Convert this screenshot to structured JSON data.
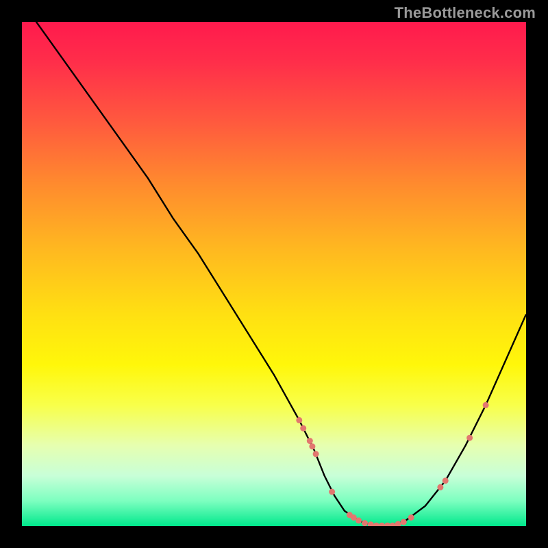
{
  "watermark": "TheBottleneck.com",
  "chart_data": {
    "type": "line",
    "title": "",
    "xlabel": "",
    "ylabel": "",
    "xlim": [
      0,
      100
    ],
    "ylim": [
      0,
      100
    ],
    "series": [
      {
        "name": "bottleneck-curve",
        "x": [
          0,
          5,
          10,
          15,
          20,
          25,
          30,
          35,
          40,
          45,
          50,
          55,
          58,
          60,
          62,
          64,
          67,
          70,
          73,
          76,
          80,
          84,
          88,
          92,
          96,
          100
        ],
        "y": [
          104,
          97,
          90,
          83,
          76,
          69,
          61,
          54,
          46,
          38,
          30,
          21,
          15,
          10,
          6,
          3,
          1,
          0,
          0,
          1,
          4,
          9,
          16,
          24,
          33,
          42
        ]
      }
    ],
    "markers": {
      "name": "highlight-points",
      "color": "#e2776f",
      "points": [
        {
          "x": 55.0,
          "y": 21.0,
          "r": 4.5
        },
        {
          "x": 55.8,
          "y": 19.4,
          "r": 4.5
        },
        {
          "x": 57.1,
          "y": 16.9,
          "r": 4.5
        },
        {
          "x": 57.6,
          "y": 15.8,
          "r": 4.5
        },
        {
          "x": 58.3,
          "y": 14.3,
          "r": 4.5
        },
        {
          "x": 61.5,
          "y": 6.8,
          "r": 4.5
        },
        {
          "x": 65.0,
          "y": 2.2,
          "r": 4.5
        },
        {
          "x": 65.8,
          "y": 1.7,
          "r": 4.5
        },
        {
          "x": 66.8,
          "y": 1.1,
          "r": 4.5
        },
        {
          "x": 68.0,
          "y": 0.6,
          "r": 4.5
        },
        {
          "x": 69.2,
          "y": 0.3,
          "r": 4.5
        },
        {
          "x": 70.3,
          "y": 0.1,
          "r": 4.5
        },
        {
          "x": 71.4,
          "y": 0.1,
          "r": 4.5
        },
        {
          "x": 72.5,
          "y": 0.1,
          "r": 4.5
        },
        {
          "x": 73.5,
          "y": 0.1,
          "r": 4.5
        },
        {
          "x": 74.6,
          "y": 0.4,
          "r": 4.5
        },
        {
          "x": 75.7,
          "y": 0.8,
          "r": 4.5
        },
        {
          "x": 77.2,
          "y": 1.7,
          "r": 4.5
        },
        {
          "x": 83.0,
          "y": 7.7,
          "r": 4.5
        },
        {
          "x": 84.0,
          "y": 9.0,
          "r": 4.5
        },
        {
          "x": 88.8,
          "y": 17.5,
          "r": 4.5
        },
        {
          "x": 92.0,
          "y": 24.0,
          "r": 4.5
        }
      ]
    },
    "background": {
      "type": "vertical-gradient",
      "stops": [
        {
          "pos": 0.0,
          "color": "#ff1a4d"
        },
        {
          "pos": 0.32,
          "color": "#ff8a2e"
        },
        {
          "pos": 0.58,
          "color": "#ffe012"
        },
        {
          "pos": 0.84,
          "color": "#e6ffb0"
        },
        {
          "pos": 1.0,
          "color": "#00e88c"
        }
      ]
    }
  }
}
